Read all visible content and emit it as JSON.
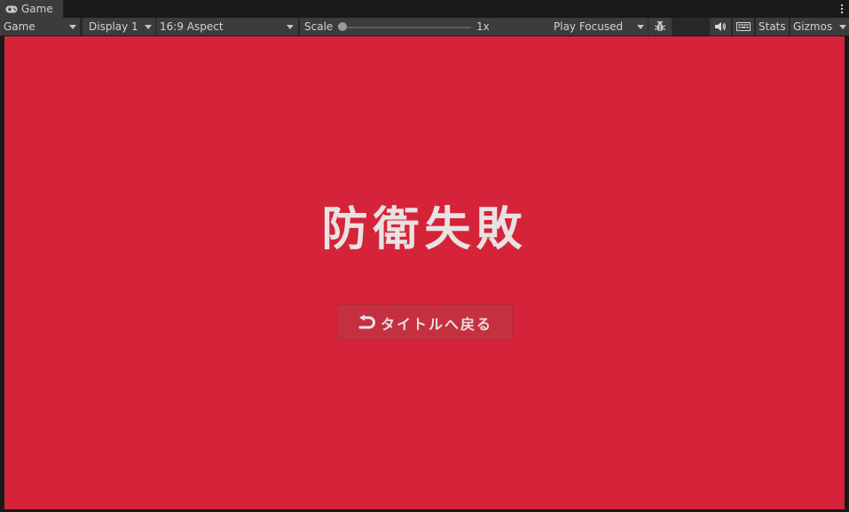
{
  "tab": {
    "title": "Game",
    "icon": "gamepad-icon"
  },
  "toolbar": {
    "view_mode": "Game",
    "display": "Display 1",
    "aspect": "16:9 Aspect",
    "scale_label": "Scale",
    "scale_value": "1x",
    "play_mode": "Play Focused",
    "stats_label": "Stats",
    "gizmos_label": "Gizmos",
    "icons": [
      "bug-icon",
      "speaker-icon",
      "keyboard-icon",
      "kebab-menu-icon"
    ]
  },
  "game": {
    "title": "防衛失敗",
    "back_button_label": "タイトルへ戻る",
    "back_icon": "return-arrow-icon",
    "background_color": "#d5243a"
  }
}
